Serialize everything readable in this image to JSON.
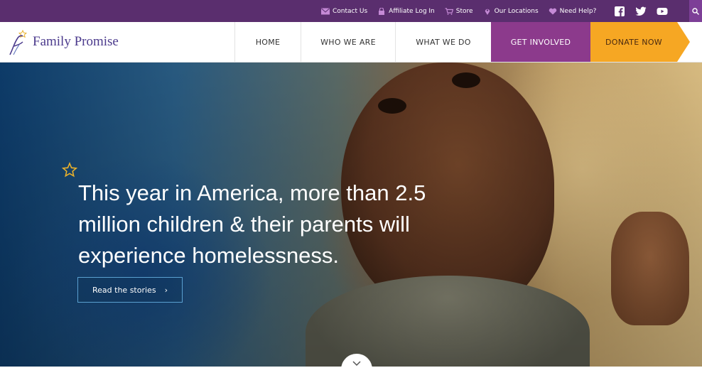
{
  "topbar": {
    "links": [
      {
        "label": "Contact Us",
        "icon": "mail-icon"
      },
      {
        "label": "Affiliate Log In",
        "icon": "lock-icon"
      },
      {
        "label": "Store",
        "icon": "cart-icon"
      },
      {
        "label": "Our Locations",
        "icon": "location-pin-icon"
      },
      {
        "label": "Need Help?",
        "icon": "heart-icon"
      }
    ],
    "social": [
      "facebook-icon",
      "twitter-icon",
      "youtube-icon"
    ],
    "search_icon": "search-icon"
  },
  "brand": {
    "name": "Family Promise"
  },
  "nav": {
    "items": [
      "HOME",
      "WHO WE ARE",
      "WHAT WE DO",
      "GET INVOLVED",
      "DONATE NOW"
    ]
  },
  "hero": {
    "headline": "This year in America, more than 2.5 million children & their parents will experience homelessness.",
    "cta_label": "Read the stories",
    "cta_chevron": "›"
  },
  "colors": {
    "topbar": "#5a2e6e",
    "get_involved": "#8c3a8c",
    "donate": "#f6a723",
    "logo_text": "#4b3a8c",
    "star": "#e8b02c"
  }
}
